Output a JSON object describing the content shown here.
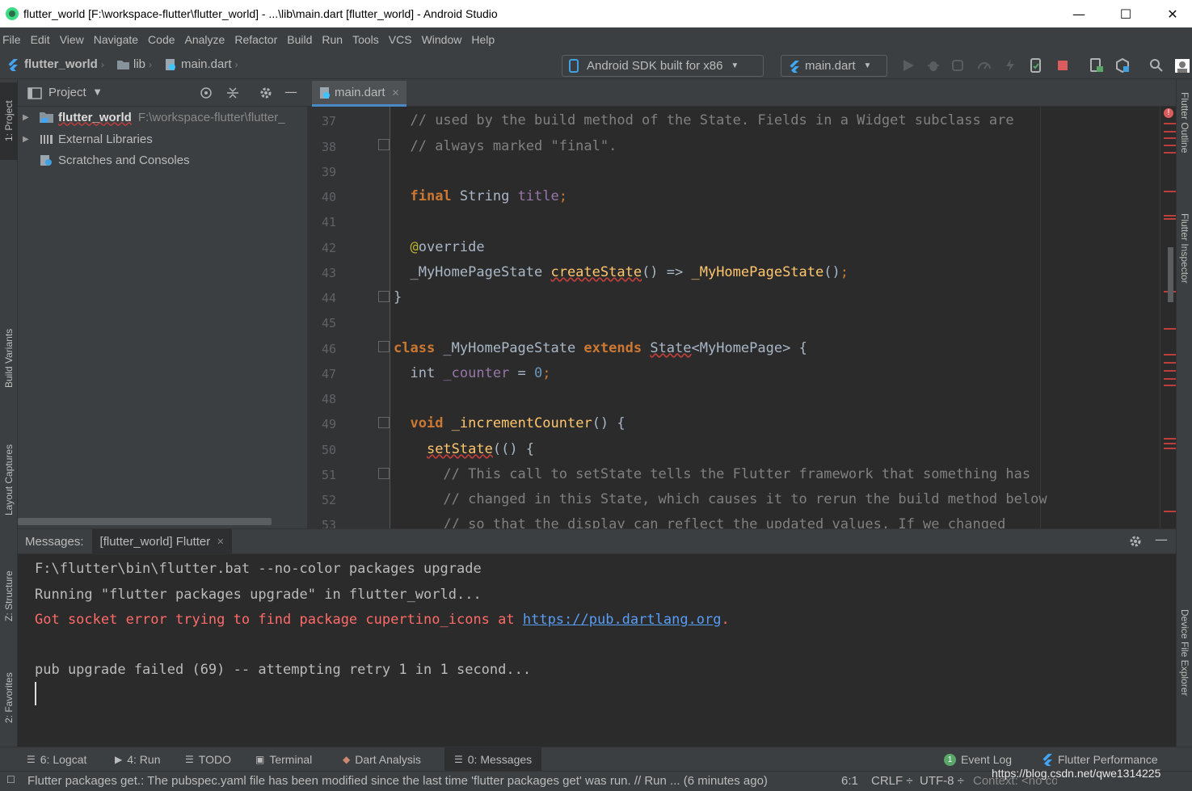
{
  "window": {
    "title": "flutter_world [F:\\workspace-flutter\\flutter_world] - ...\\lib\\main.dart [flutter_world] - Android Studio",
    "minimize": "—",
    "maximize": "☐",
    "close": "✕"
  },
  "menu": [
    "File",
    "Edit",
    "View",
    "Navigate",
    "Code",
    "Analyze",
    "Refactor",
    "Build",
    "Run",
    "Tools",
    "VCS",
    "Window",
    "Help"
  ],
  "breadcrumb": {
    "project": "flutter_world",
    "folder": "lib",
    "file": "main.dart"
  },
  "toolbar": {
    "device": "Android SDK built for x86",
    "run_config": "main.dart"
  },
  "left_tabs": {
    "project": "1: Project",
    "build_variants": "Build Variants",
    "layout_captures": "Layout Captures",
    "structure": "Z: Structure",
    "favorites": "2: Favorites"
  },
  "right_tabs": {
    "flutter_outline": "Flutter Outline",
    "flutter_inspector": "Flutter Inspector",
    "device_file_explorer": "Device File Explorer"
  },
  "project_panel": {
    "title": "Project",
    "tree": {
      "root_name": "flutter_world",
      "root_path": "F:\\workspace-flutter\\flutter_",
      "external": "External Libraries",
      "scratches": "Scratches and Consoles"
    }
  },
  "editor": {
    "tab": "main.dart",
    "line_numbers": [
      "37",
      "38",
      "39",
      "40",
      "41",
      "42",
      "43",
      "44",
      "45",
      "46",
      "47",
      "48",
      "49",
      "50",
      "51",
      "52",
      "53"
    ]
  },
  "messages": {
    "label": "Messages:",
    "tab": "[flutter_world] Flutter",
    "lines": {
      "l1": "F:\\flutter\\bin\\flutter.bat --no-color packages upgrade",
      "l2": "Running \"flutter packages upgrade\" in flutter_world...",
      "l3": "Got socket error trying to find package cupertino_icons at ",
      "l3_link": "https://pub.dartlang.org",
      "l3_end": ".",
      "l4": "pub upgrade failed (69) -- attempting retry 1 in 1 second..."
    }
  },
  "bottom_tabs": {
    "logcat": "6: Logcat",
    "run": "4: Run",
    "todo": "TODO",
    "terminal": "Terminal",
    "dart_analysis": "Dart Analysis",
    "messages": "0: Messages",
    "event_log": "Event Log",
    "flutter_performance": "Flutter Performance"
  },
  "status": {
    "message": "Flutter packages get.: The pubspec.yaml file has been modified since the last time 'flutter packages get' was run. // Run ... (6 minutes ago)",
    "position": "6:1",
    "line_sep": "CRLF ÷",
    "encoding": "UTF-8 ÷",
    "context": "Context: <no context>",
    "watermark": "https://blog.csdn.net/qwe1314225"
  },
  "colors": {
    "keyword": "#cc7832",
    "comment": "#808080",
    "function": "#ffc66d",
    "field": "#9876aa",
    "number": "#6897bb",
    "error": "#ff6b68",
    "link": "#589df6"
  }
}
